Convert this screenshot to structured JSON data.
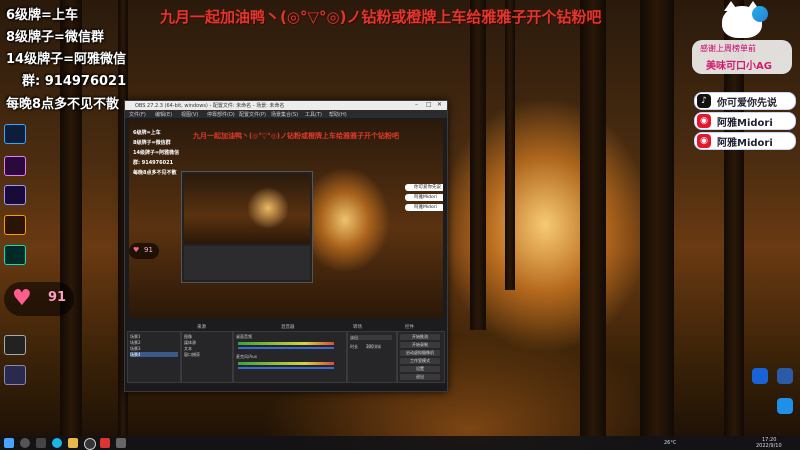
{
  "banner": {
    "headline": "九月一起加油鸭丶(◎°▽°◎)ノ钻粉或橙牌上车给雅雅子开个钻粉吧"
  },
  "left_overlay": {
    "lines": [
      "6级牌=上车",
      "8级牌子=微信群",
      "14级牌子=阿雅微信",
      "群: 914976021",
      "每晚8点多不见不散"
    ]
  },
  "heart_badge": {
    "icon": "heart-icon",
    "count": "91"
  },
  "cat_card": {
    "line1": "感谢上周榜单前",
    "line2": "美味可口小AG"
  },
  "social_badges": [
    {
      "icon": "tiktok-icon",
      "label": "你可爱你先说",
      "color": "#111111"
    },
    {
      "icon": "weibo-icon",
      "label": "阿雅Midori",
      "color": "#e6162d"
    },
    {
      "icon": "weibo-icon",
      "label": "阿雅Midori",
      "color": "#e6162d"
    }
  ],
  "obs": {
    "title": "OBS 27.2.3 (64-bit, windows) - 配置文件: 未命名 - 场景: 未命名",
    "menu": [
      "文件(F)",
      "编辑(E)",
      "视图(V)",
      "停靠部件(D)",
      "配置文件(P)",
      "场景集合(S)",
      "工具(T)",
      "帮助(H)"
    ],
    "dock_titles": [
      "来源",
      "混音器",
      "转场",
      "控件"
    ],
    "scenes_items": [
      "场景1",
      "场景2",
      "场景3",
      "场景4"
    ],
    "sources_items": [
      "图像",
      "媒体源",
      "文本",
      "窗口捕获"
    ],
    "mixer": [
      "桌面音频",
      "麦克风/Aux"
    ],
    "transition": [
      "淡出",
      "时长",
      "300 ms"
    ],
    "controls": [
      "开始推流",
      "开始录制",
      "启动虚拟摄像机",
      "工作室模式",
      "设置",
      "退出"
    ],
    "preview_left": [
      "6级牌=上车",
      "8级牌子=微信群",
      "14级牌子=阿雅微信",
      "群: 914976021",
      "每晚8点多不见不散"
    ],
    "preview_heart": "91",
    "preview_badges": [
      "你可爱你先说",
      "阿雅Midori",
      "阿雅Midori"
    ]
  },
  "taskbar": {
    "time": "17:20",
    "date": "2022/9/10",
    "temp": "26°C"
  },
  "colors": {
    "headline": "#e0372c",
    "accent_pink": "#ff5d8f"
  }
}
